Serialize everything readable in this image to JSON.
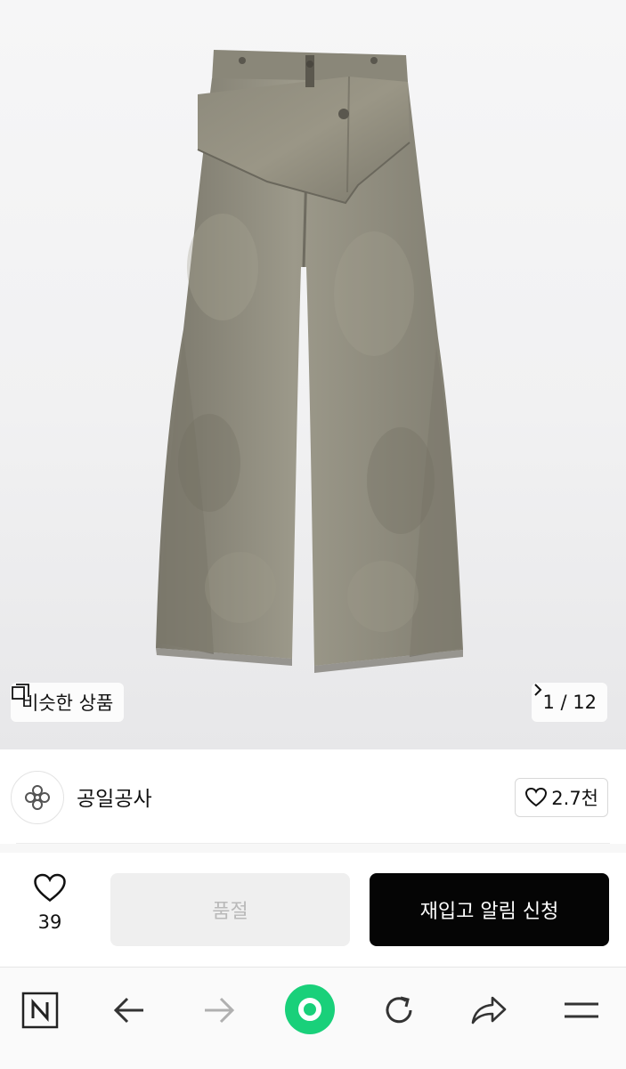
{
  "hero": {
    "similar_label": "비슷한 상품",
    "counter_text": "1 / 12",
    "icons": {
      "similar": "similar-items-icon",
      "next": "chevron-right-icon"
    }
  },
  "brand": {
    "name": "공일공사",
    "likes": "2.7천",
    "icons": {
      "logo": "brand-logo",
      "like": "heart-outline-icon"
    }
  },
  "actions": {
    "wish_count": "39",
    "soldout_label": "품절",
    "restock_label": "재입고 알림 신청",
    "colors": {
      "soldout_bg": "#efefef",
      "restock_bg": "#050505",
      "brand_green": "#19d07a"
    }
  },
  "browser_toolbar": {
    "items": [
      "naver-home-icon",
      "back-arrow-icon",
      "forward-arrow-icon",
      "green-dot-icon",
      "refresh-icon",
      "share-icon",
      "menu-icon"
    ]
  }
}
